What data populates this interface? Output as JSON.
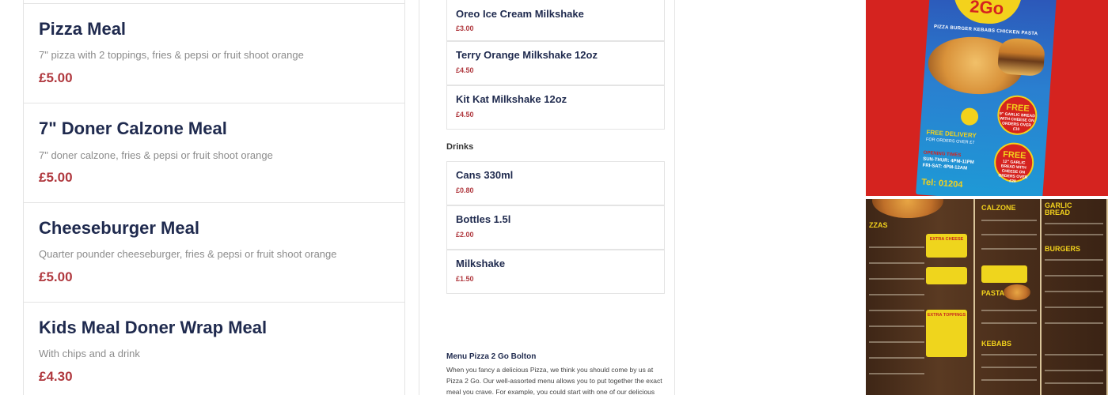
{
  "meals": [
    {
      "name": "Pizza Meal",
      "description": "7\" pizza with 2 toppings, fries & pepsi or fruit shoot orange",
      "price": "£5.00"
    },
    {
      "name": "7\" Doner Calzone Meal",
      "description": "7\" doner calzone, fries & pepsi or fruit shoot orange",
      "price": "£5.00"
    },
    {
      "name": "Cheeseburger Meal",
      "description": "Quarter pounder cheeseburger, fries & pepsi or fruit shoot orange",
      "price": "£5.00"
    },
    {
      "name": "Kids Meal Doner Wrap Meal",
      "description": "With chips and a drink",
      "price": "£4.30"
    }
  ],
  "milkshakes": [
    {
      "name": "Oreo Ice Cream Milkshake",
      "price": "£3.00"
    },
    {
      "name": "Terry Orange Milkshake 12oz",
      "price": "£4.50"
    },
    {
      "name": "Kit Kat Milkshake 12oz",
      "price": "£4.50"
    }
  ],
  "drinks_section": {
    "heading": "Drinks",
    "items": [
      {
        "name": "Cans 330ml",
        "price": "£0.80"
      },
      {
        "name": "Bottles 1.5l",
        "price": "£2.00"
      },
      {
        "name": "Milkshake",
        "price": "£1.50"
      }
    ]
  },
  "about": {
    "title": "Menu Pizza 2 Go Bolton",
    "text": "When you fancy a delicious Pizza, we think you should come by us at Pizza 2 Go. Our well-assorted menu allows you to put together the exact meal you crave. For example, you could start with one of our delicious Mixed Salad,"
  },
  "photos": {
    "flyer": {
      "logo": "2Go",
      "categories": "PIZZA  BURGER  KEBABS  CHICKEN  PASTA",
      "badge_top": {
        "big": "FREE",
        "small": "9\" GARLIC BREAD WITH CHEESE ON ORDERS OVER £10"
      },
      "badge_bottom": {
        "big": "FREE",
        "small": "12\" GARLIC BREAD WITH CHEESE ON ORDERS OVER £20"
      },
      "free_delivery": "FREE DELIVERY",
      "free_delivery_sub": "FOR ORDERS OVER £7",
      "hours_title": "OPENING TIMES",
      "hours_1": "SUN-THUR: 4PM-11PM",
      "hours_2": "FRI-SAT: 4PM-12AM",
      "tel": "Tel: 01204"
    },
    "board": {
      "headings": [
        "ZZAS",
        "CALZONE",
        "GARLIC BREAD",
        "BURGERS",
        "PASTA",
        "KEBABS"
      ],
      "extra_cheese": "EXTRA CHEESE",
      "extra_toppings": "EXTRA TOPPINGS"
    }
  },
  "colors": {
    "title_navy": "#1f2a4e",
    "price_red": "#b0393f",
    "muted_text": "#8c8c8c",
    "border": "#e4e4e4",
    "flyer_red": "#d5231f",
    "flyer_yellow": "#f3d21c"
  }
}
